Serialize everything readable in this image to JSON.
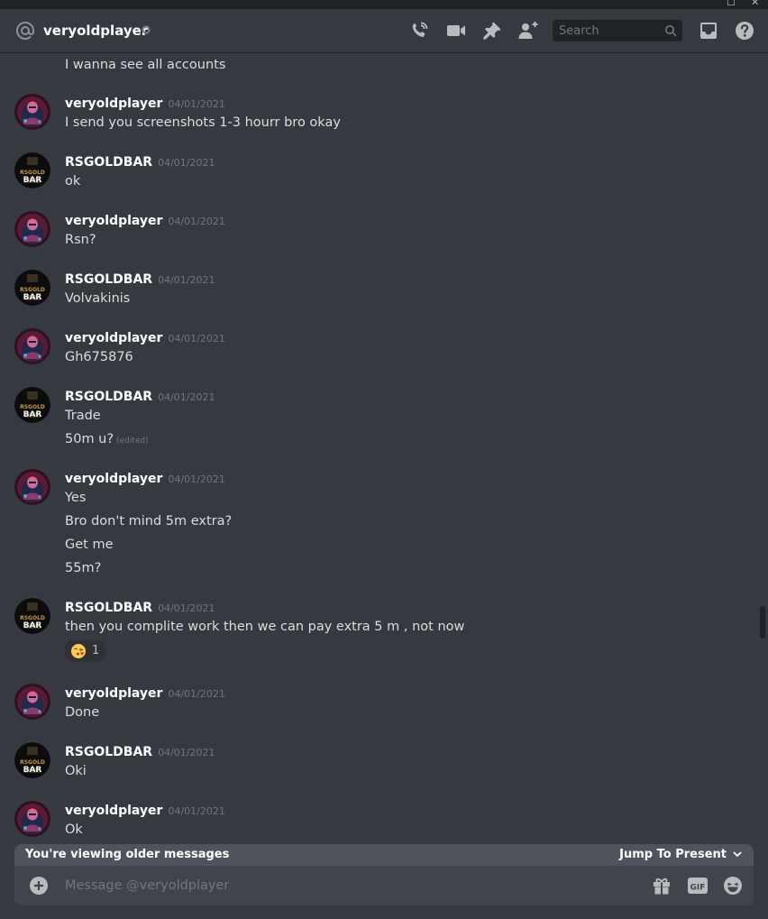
{
  "header": {
    "username": "veryoldplayer",
    "search_placeholder": "Search",
    "icons": [
      "at-icon",
      "status-offline-icon",
      "phone-call-icon",
      "video-call-icon",
      "pin-icon",
      "add-friend-icon",
      "search-icon",
      "inbox-icon",
      "help-icon"
    ]
  },
  "messages": [
    {
      "type": "continuation",
      "lines": [
        "I wanna see all accounts"
      ]
    },
    {
      "author": "veryoldplayer",
      "timestamp": "04/01/2021",
      "lines": [
        "I send you screenshots 1-3 hourr bro okay"
      ]
    },
    {
      "author": "RSGOLDBAR",
      "timestamp": "04/01/2021",
      "lines": [
        "ok"
      ]
    },
    {
      "author": "veryoldplayer",
      "timestamp": "04/01/2021",
      "lines": [
        "Rsn?"
      ]
    },
    {
      "author": "RSGOLDBAR",
      "timestamp": "04/01/2021",
      "lines": [
        "Volvakinis"
      ]
    },
    {
      "author": "veryoldplayer",
      "timestamp": "04/01/2021",
      "lines": [
        "Gh675876"
      ]
    },
    {
      "author": "RSGOLDBAR",
      "timestamp": "04/01/2021",
      "lines": [
        "Trade",
        "50m u?"
      ],
      "edited_label": "(edited)"
    },
    {
      "author": "veryoldplayer",
      "timestamp": "04/01/2021",
      "lines": [
        "Yes",
        "Bro don't mind 5m extra?",
        "Get me",
        "55m?"
      ]
    },
    {
      "author": "RSGOLDBAR",
      "timestamp": "04/01/2021",
      "lines": [
        "then you complite work then we can pay extra 5 m , not now"
      ],
      "reaction": {
        "emoji": "kissing-face-emoji",
        "count": "1"
      }
    },
    {
      "author": "veryoldplayer",
      "timestamp": "04/01/2021",
      "lines": [
        "Done"
      ]
    },
    {
      "author": "RSGOLDBAR",
      "timestamp": "04/01/2021",
      "lines": [
        "Oki"
      ]
    },
    {
      "author": "veryoldplayer",
      "timestamp": "04/01/2021",
      "lines": [
        "Ok"
      ]
    }
  ],
  "avatars": {
    "rsgoldbar_logo_text_top": "RSGOLD",
    "rsgoldbar_logo_text_bottom": "BAR"
  },
  "older_bar": {
    "label": "You're viewing older messages",
    "jump_label": "Jump To Present"
  },
  "composer": {
    "placeholder": "Message @veryoldplayer",
    "gif_label": "GIF"
  },
  "colors": {
    "background": "#36393f",
    "header_text": "#ffffff",
    "message_text": "#dcddde",
    "timestamp": "#72767d",
    "older_bar": "#4f545c",
    "composer": "#40444b",
    "search_bg": "#202225"
  }
}
